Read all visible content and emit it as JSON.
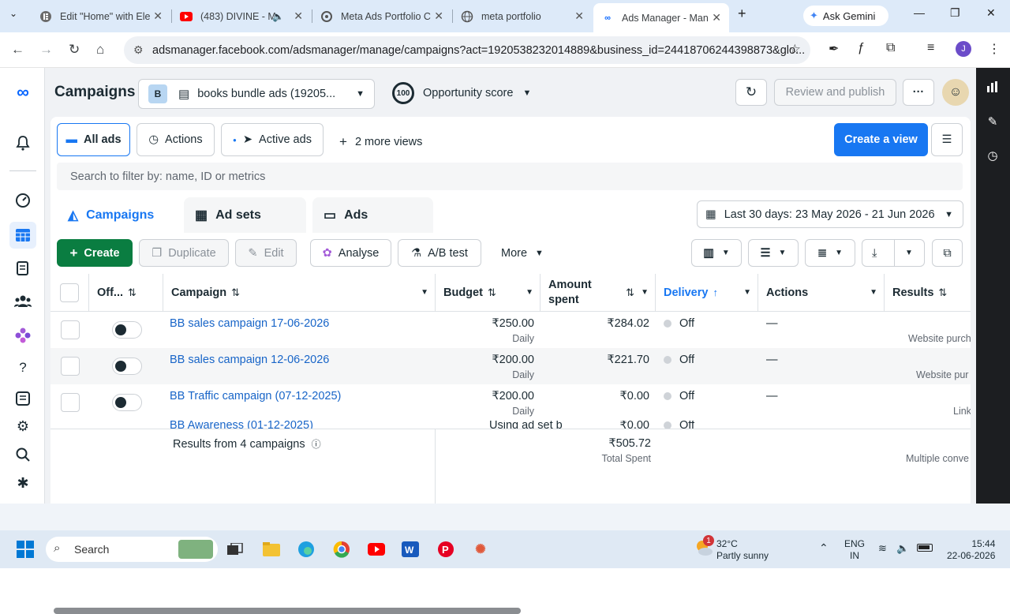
{
  "browser": {
    "tabs": [
      {
        "title": "Edit \"Home\" with Ele",
        "icon": "elementor-icon"
      },
      {
        "title": "(483) DIVINE - M",
        "icon": "youtube-icon"
      },
      {
        "title": "Meta Ads Portfolio C",
        "icon": "openai-icon"
      },
      {
        "title": "meta portfolio",
        "icon": "globe-icon"
      },
      {
        "title": "Ads Manager - Man",
        "icon": "meta-icon"
      }
    ],
    "gemini_label": "Ask Gemini",
    "url": "adsmanager.facebook.com/adsmanager/manage/campaigns?act=1920538232014889&business_id=24418706244398873&glo...",
    "profile_letter": "J"
  },
  "header": {
    "title": "Campaigns",
    "account_badge": "B",
    "account_name": "books bundle ads (19205...",
    "opportunity_value": "100",
    "opportunity_label": "Opportunity score",
    "review_label": "Review and publish",
    "more_label": "···"
  },
  "views": {
    "all_ads": "All ads",
    "actions": "Actions",
    "active_ads": "Active ads",
    "more_views": "2 more views",
    "create_view": "Create a view"
  },
  "search_placeholder": "Search to filter by: name, ID or metrics",
  "level_tabs": [
    "Campaigns",
    "Ad sets",
    "Ads"
  ],
  "date_range": "Last 30 days: 23 May 2026 - 21 Jun 2026",
  "toolbar": {
    "create": "Create",
    "duplicate": "Duplicate",
    "edit": "Edit",
    "analyse": "Analyse",
    "ab_test": "A/B test",
    "more": "More"
  },
  "table": {
    "columns": [
      "Off...",
      "Campaign",
      "Budget",
      "Amount spent",
      "Delivery",
      "Actions",
      "Results"
    ],
    "rows": [
      {
        "name": "BB sales campaign 17-06-2026",
        "budget": "₹250.00",
        "budget_type": "Daily",
        "spent": "₹284.02",
        "delivery": "Off",
        "actions": "—",
        "results": "Website purch"
      },
      {
        "name": "BB sales campaign 12-06-2026",
        "budget": "₹200.00",
        "budget_type": "Daily",
        "spent": "₹221.70",
        "delivery": "Off",
        "actions": "—",
        "results": "Website pur"
      },
      {
        "name": "BB Traffic campaign (07-12-2025)",
        "budget": "₹200.00",
        "budget_type": "Daily",
        "spent": "₹0.00",
        "delivery": "Off",
        "actions": "—",
        "results": "Link"
      },
      {
        "name": "BB Awareness (01-12-2025)",
        "budget": "Using ad set b",
        "budget_type": "",
        "spent": "₹0.00",
        "delivery": "Off",
        "actions": "",
        "results": ""
      }
    ],
    "summary": {
      "label": "Results from 4 campaigns",
      "total": "₹505.72",
      "total_label": "Total Spent",
      "results": "Multiple conve"
    }
  },
  "taskbar": {
    "search": "Search",
    "weather_temp": "32°C",
    "weather_desc": "Partly sunny",
    "weather_badge": "1",
    "lang_top": "ENG",
    "lang_bottom": "IN",
    "time": "15:44",
    "date": "22-06-2026"
  }
}
